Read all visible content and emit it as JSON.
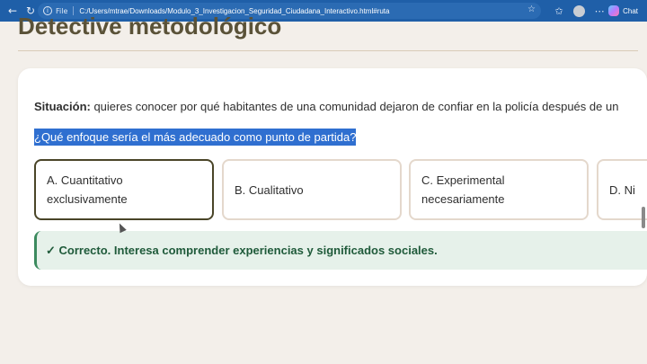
{
  "browser": {
    "file_label": "File",
    "url": "C:/Users/mtrae/Downloads/Modulo_3_Investigacion_Seguridad_Ciudadana_Interactivo.html#ruta",
    "copilot_label": "Chat"
  },
  "page": {
    "title": "Detective metodológico"
  },
  "scenario": {
    "situation_label": "Situación:",
    "situation_text": " quieres conocer por qué habitantes de una comunidad dejaron de confiar en la policía después de un",
    "question": "¿Qué enfoque sería el más adecuado como punto de partida?"
  },
  "options": [
    {
      "label": "A. Cuantitativo exclusivamente",
      "selected": true
    },
    {
      "label": "B. Cualitativo",
      "selected": false
    },
    {
      "label": "C. Experimental necesariamente",
      "selected": false
    },
    {
      "label": "D. Ni",
      "selected": false
    }
  ],
  "feedback": {
    "text": "✓ Correcto. Interesa comprender experiencias y significados sociales."
  }
}
